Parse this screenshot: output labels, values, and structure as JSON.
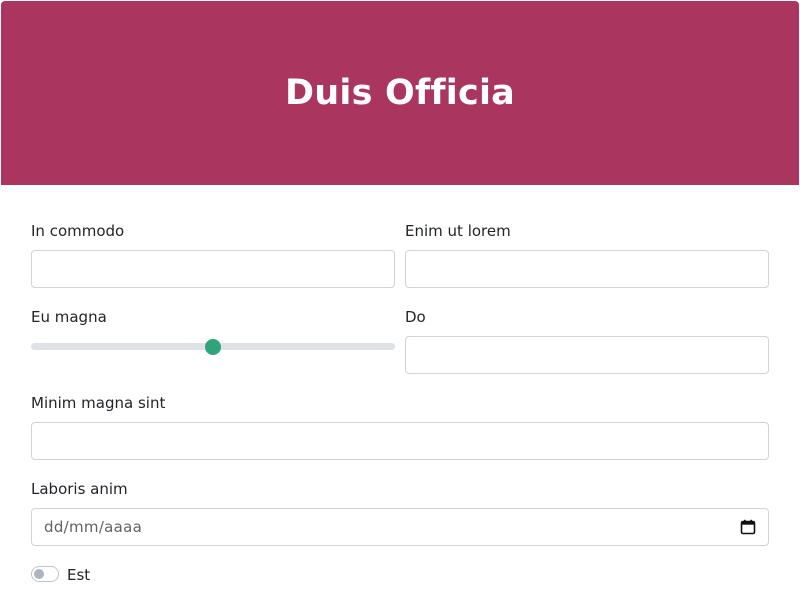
{
  "header": {
    "title": "Duis Officia",
    "color": "#aa355e"
  },
  "form": {
    "field1": {
      "label": "In commodo",
      "value": ""
    },
    "field2": {
      "label": "Enim ut lorem",
      "value": ""
    },
    "slider": {
      "label": "Eu magna",
      "value": 50,
      "min": 0,
      "max": 100,
      "accent": "#2fa37a"
    },
    "field3": {
      "label": "Do",
      "value": ""
    },
    "field4": {
      "label": "Minim magna sint",
      "value": ""
    },
    "date": {
      "label": "Laboris anim",
      "placeholder": "dd/mm/aaaa"
    },
    "toggle": {
      "label": "Est",
      "checked": false
    }
  },
  "icons": {
    "calendar": "calendar-icon"
  }
}
